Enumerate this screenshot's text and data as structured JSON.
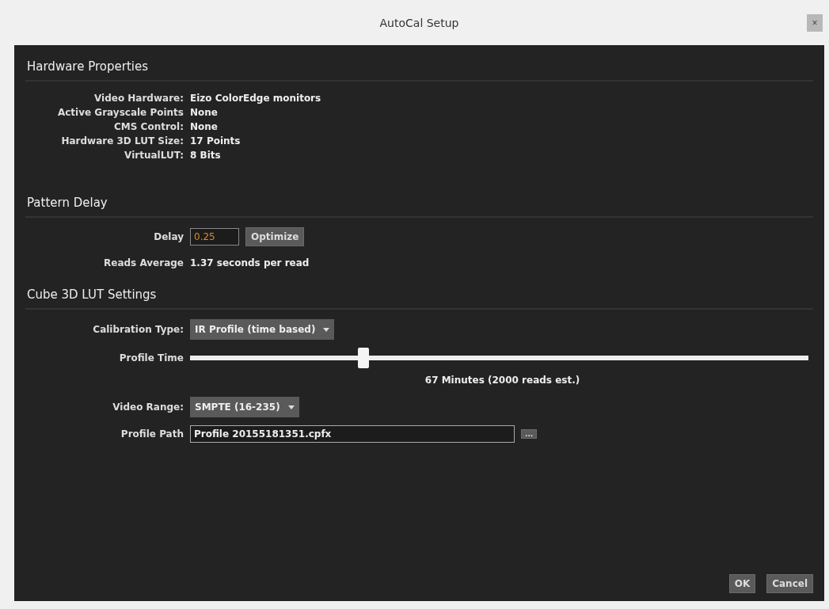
{
  "window": {
    "title": "AutoCal Setup",
    "close": "×"
  },
  "hardware": {
    "title": "Hardware Properties",
    "rows": [
      {
        "label": "Video Hardware:",
        "value": "Eizo ColorEdge monitors"
      },
      {
        "label": "Active Grayscale Points",
        "value": "None"
      },
      {
        "label": "CMS Control:",
        "value": "None"
      },
      {
        "label": "Hardware 3D LUT Size:",
        "value": "17 Points"
      },
      {
        "label": "VirtualLUT:",
        "value": "8 Bits"
      }
    ]
  },
  "pattern_delay": {
    "title": "Pattern Delay",
    "delay_label": "Delay",
    "delay_value": "0.25",
    "optimize": "Optimize",
    "reads_label": "Reads Average",
    "reads_value": "1.37  seconds per read"
  },
  "cube": {
    "title": "Cube 3D LUT Settings",
    "calibration_label": "Calibration Type:",
    "calibration_value": "IR Profile (time based)",
    "profile_time_label": "Profile Time",
    "profile_time": {
      "level": 0.28
    },
    "profile_time_reading": "67 Minutes (2000 reads est.)",
    "video_range_label": "Video Range:",
    "video_range_value": "SMPTE (16-235)",
    "profile_path_label": "Profile Path",
    "profile_path_value": "Profile 20155181351.cpfx",
    "browse": "..."
  },
  "buttons": [
    "OK",
    "Cancel"
  ]
}
